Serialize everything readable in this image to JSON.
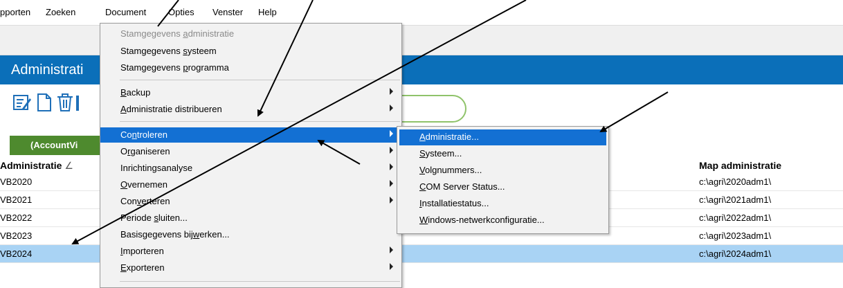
{
  "menubar": {
    "items": [
      "pporten",
      "Zoeken",
      "Document",
      "Opties",
      "Venster",
      "Help"
    ]
  },
  "header": {
    "title": "Administrati"
  },
  "tab": {
    "label": "(AccountVi"
  },
  "columns": {
    "admin": "Administratie",
    "sort_glyph": "∠",
    "folder": "Map administratie"
  },
  "rows": [
    {
      "name": "VB2020",
      "folder": "c:\\agri\\2020adm1\\"
    },
    {
      "name": "VB2021",
      "folder": "c:\\agri\\2021adm1\\"
    },
    {
      "name": "VB2022",
      "folder": "c:\\agri\\2022adm1\\"
    },
    {
      "name": "VB2023",
      "folder": "c:\\agri\\2023adm1\\"
    },
    {
      "name": "VB2024",
      "folder": "c:\\agri\\2024adm1\\",
      "selected": true
    }
  ],
  "document_menu": {
    "items": [
      {
        "a": "Stamgegevens ",
        "u": "a",
        "b": "dministratie",
        "disabled": true,
        "submenu": false
      },
      {
        "a": "Stamgegevens ",
        "u": "s",
        "b": "ysteem",
        "disabled": false,
        "submenu": false
      },
      {
        "a": "Stamgegevens ",
        "u": "p",
        "b": "rogramma",
        "disabled": false,
        "submenu": false
      },
      {
        "a": "",
        "u": "B",
        "b": "ackup",
        "disabled": false,
        "submenu": true
      },
      {
        "a": "",
        "u": "A",
        "b": "dministratie distribueren",
        "disabled": false,
        "submenu": true
      },
      {
        "a": "Co",
        "u": "n",
        "b": "troleren",
        "disabled": false,
        "submenu": true,
        "highlighted": true
      },
      {
        "a": "O",
        "u": "r",
        "b": "ganiseren",
        "disabled": false,
        "submenu": true
      },
      {
        "a": "Inrichtingsanalyse",
        "u": "",
        "b": "",
        "disabled": false,
        "submenu": true
      },
      {
        "a": "",
        "u": "O",
        "b": "vernemen",
        "disabled": false,
        "submenu": true
      },
      {
        "a": "Con",
        "u": "v",
        "b": "erteren",
        "disabled": false,
        "submenu": true
      },
      {
        "a": "Periode ",
        "u": "s",
        "b": "luiten...",
        "disabled": false,
        "submenu": false
      },
      {
        "a": "Basisgegevens bij",
        "u": "w",
        "b": "erken...",
        "disabled": false,
        "submenu": false
      },
      {
        "a": "",
        "u": "I",
        "b": "mporteren",
        "disabled": false,
        "submenu": true
      },
      {
        "a": "",
        "u": "E",
        "b": "xporteren",
        "disabled": false,
        "submenu": true
      }
    ]
  },
  "controleren_submenu": {
    "items": [
      {
        "a": "",
        "u": "A",
        "b": "dministratie...",
        "highlighted": true
      },
      {
        "a": "",
        "u": "S",
        "b": "ysteem..."
      },
      {
        "a": "",
        "u": "V",
        "b": "olgnummers..."
      },
      {
        "a": "",
        "u": "C",
        "b": "OM Server Status..."
      },
      {
        "a": "",
        "u": "I",
        "b": "nstallatiestatus..."
      },
      {
        "a": "",
        "u": "W",
        "b": "indows-netwerkconfiguratie..."
      }
    ]
  },
  "colors": {
    "accent": "#0b6fb9",
    "highlight": "#1370d3",
    "selected_row": "#a9d3f4",
    "tab_green": "#4e8a2e"
  },
  "icons": [
    "edit-icon",
    "new-document-icon",
    "delete-icon"
  ]
}
